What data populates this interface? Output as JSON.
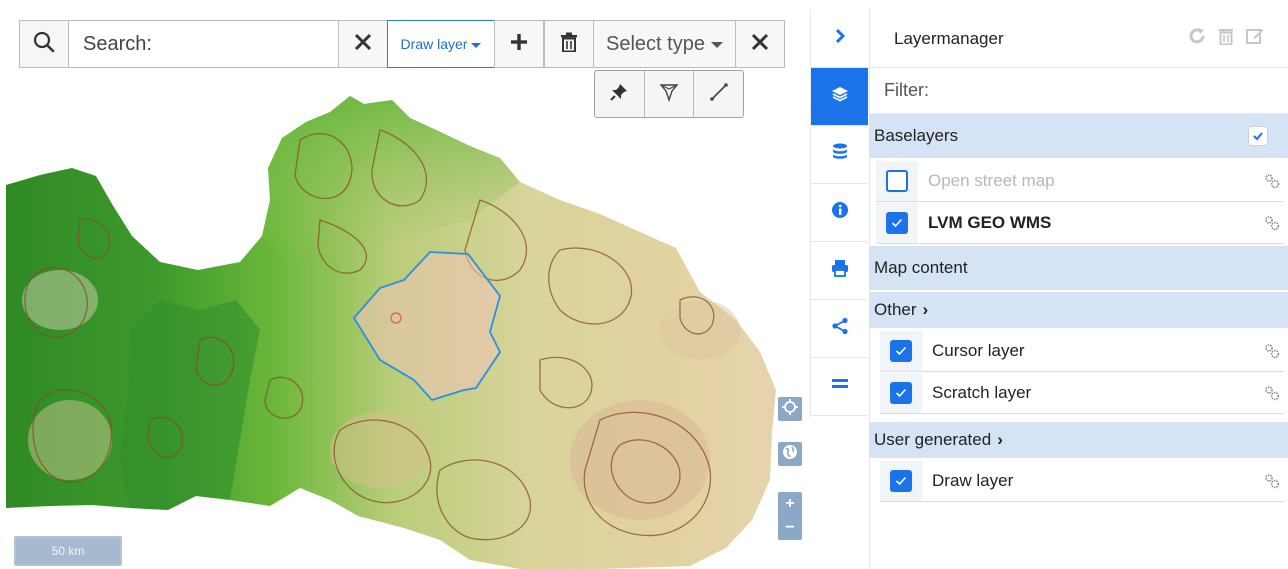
{
  "search": {
    "placeholder": "Search:"
  },
  "toolbar": {
    "draw_layer_label": "Draw layer",
    "select_type_label": "Select type"
  },
  "map": {
    "scale_label": "50 km"
  },
  "rail": {
    "items": [
      "chevron-right-icon",
      "layers-icon",
      "database-icon",
      "info-icon",
      "print-icon",
      "share-icon",
      "menu-icon"
    ],
    "active_index": 1
  },
  "panel": {
    "title": "Layermanager",
    "filter_placeholder": "Filter:",
    "baselayers": {
      "title": "Baselayers",
      "all_checked": true,
      "items": [
        {
          "label": "Open street map",
          "checked": false
        },
        {
          "label": "LVM GEO WMS",
          "checked": true
        }
      ]
    },
    "map_content": {
      "title": "Map content",
      "groups": [
        {
          "title": "Other",
          "items": [
            {
              "label": "Cursor layer",
              "checked": true
            },
            {
              "label": "Scratch layer",
              "checked": true
            }
          ]
        },
        {
          "title": "User generated",
          "items": [
            {
              "label": "Draw layer",
              "checked": true
            }
          ]
        }
      ]
    }
  },
  "colors": {
    "accent": "#1a73e8",
    "group_header_bg": "#d6e3f4",
    "map_control": "#8ba8c6"
  }
}
